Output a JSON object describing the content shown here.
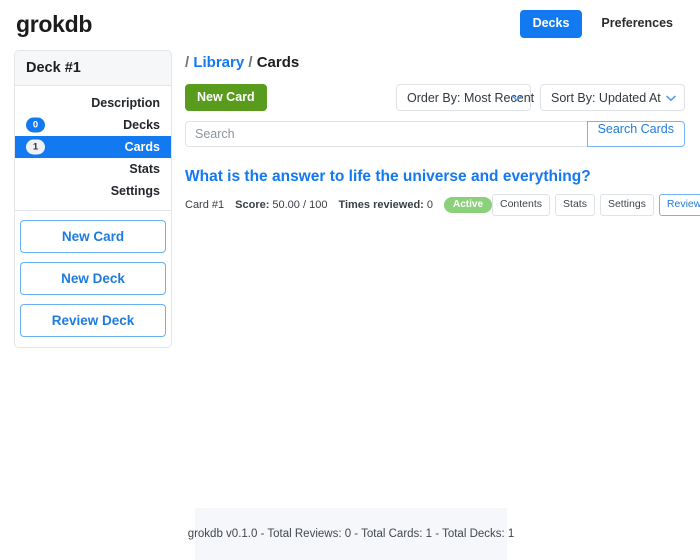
{
  "header": {
    "brand": "grokdb",
    "nav": [
      {
        "label": "Decks",
        "style": "primary",
        "name": "nav-decks"
      },
      {
        "label": "Preferences",
        "style": "plain",
        "name": "nav-preferences"
      }
    ]
  },
  "sidebar": {
    "title": "Deck #1",
    "items": [
      {
        "label": "Description",
        "badge": null,
        "active": false
      },
      {
        "label": "Decks",
        "badge": "0",
        "active": false
      },
      {
        "label": "Cards",
        "badge": "1",
        "active": true
      },
      {
        "label": "Stats",
        "badge": null,
        "active": false
      },
      {
        "label": "Settings",
        "badge": null,
        "active": false
      }
    ],
    "actions": [
      {
        "label": "New Card"
      },
      {
        "label": "New Deck"
      },
      {
        "label": "Review Deck"
      }
    ]
  },
  "breadcrumb": {
    "sep1": "/",
    "link": "Library",
    "sep2": "/",
    "current": "Cards"
  },
  "toolbar": {
    "new_card_label": "New Card",
    "order_by": "Order By: Most Recent",
    "sort_by": "Sort By: Updated At"
  },
  "search": {
    "value": "",
    "placeholder": "Search",
    "button_label": "Search Cards"
  },
  "results": [
    {
      "title": "What is the answer to life the universe and everything?",
      "card_id": "Card #1",
      "score_label": "Score:",
      "score_value": "50.00 / 100",
      "reviewed_label": "Times reviewed:",
      "reviewed_value": "0",
      "status": "Active",
      "actions": [
        {
          "label": "Contents",
          "style": "plain"
        },
        {
          "label": "Stats",
          "style": "plain"
        },
        {
          "label": "Settings",
          "style": "plain"
        },
        {
          "label": "Review",
          "style": "link"
        }
      ]
    }
  ],
  "footer": {
    "text": "grokdb v0.1.0 - Total Reviews: 0 - Total Cards: 1 - Total Decks: 1"
  },
  "colors": {
    "primary_blue": "#1379f1",
    "link_blue": "#1f7be0",
    "green_button": "#599b1c",
    "status_green": "#8bd07a",
    "border_gray": "#dfe2e6",
    "panel_head_gray": "#f6f7f9",
    "footer_gray": "#f5f7fa"
  }
}
